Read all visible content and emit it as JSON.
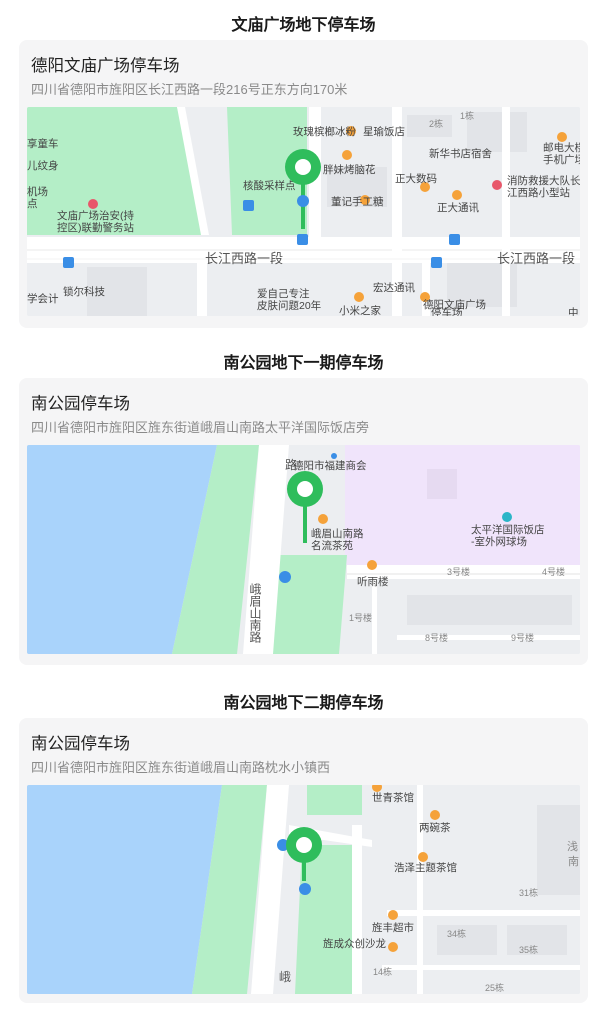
{
  "colors": {
    "park": "#b4eec7",
    "water": "#a9d3fb",
    "road": "#ffffff",
    "ground": "#eceef1",
    "poi": "#f5a23a",
    "marker": "#2fbd5c",
    "bus": "#3a8ee6",
    "hotel_area": "#f0e4fb"
  },
  "cards": [
    {
      "section_title": "文庙广场地下停车场",
      "name": "德阳文庙广场停车场",
      "address": "四川省德阳市旌阳区长江西路一段216号正东方向170米",
      "map": {
        "roads": [
          "长江西路一段",
          "长江西路一段"
        ],
        "labels": [
          "享童车",
          "儿纹身",
          "机场",
          "点",
          "文庙广场治安(持",
          "控区)联勤警务站",
          "玫瑰槟榔冰粉",
          "星瑜饭店",
          "2栋",
          "1栋",
          "邮电大楼",
          "手机广场",
          "新华书店宿舍",
          "胖妹烤脑花",
          "核酸采样点",
          "正大数码",
          "消防救援大队长",
          "江西路小型站",
          "董记手工糖",
          "正大通讯",
          "学会计",
          "锁尔科技",
          "宏达通讯",
          "爱自己专注",
          "皮肤问题20年",
          "德阳文庙广场",
          "停车场",
          "小米之家",
          "中"
        ]
      }
    },
    {
      "section_title": "南公园地下一期停车场",
      "name": "南公园停车场",
      "address": "四川省德阳市旌阳区旌东街道峨眉山南路太平洋国际饭店旁",
      "map": {
        "roads": [
          "路",
          "峨眉山南路"
        ],
        "labels": [
          "德阳市福建商会",
          "峨眉山南路",
          "名流茶苑",
          "太平洋国际饭店",
          "-室外网球场",
          "听雨楼",
          "3号楼",
          "4号楼",
          "1号楼",
          "8号楼",
          "9号楼"
        ]
      }
    },
    {
      "section_title": "南公园地下二期停车场",
      "name": "南公园停车场",
      "address": "四川省德阳市旌阳区旌东街道峨眉山南路枕水小镇西",
      "map": {
        "roads": [
          "峨"
        ],
        "labels": [
          "世青茶馆",
          "两碗茶",
          "浅",
          "南",
          "浩泽主题茶馆",
          "31栋",
          "旌丰超市",
          "34栋",
          "旌成众创沙龙",
          "35栋",
          "14栋",
          "25栋"
        ]
      }
    }
  ]
}
